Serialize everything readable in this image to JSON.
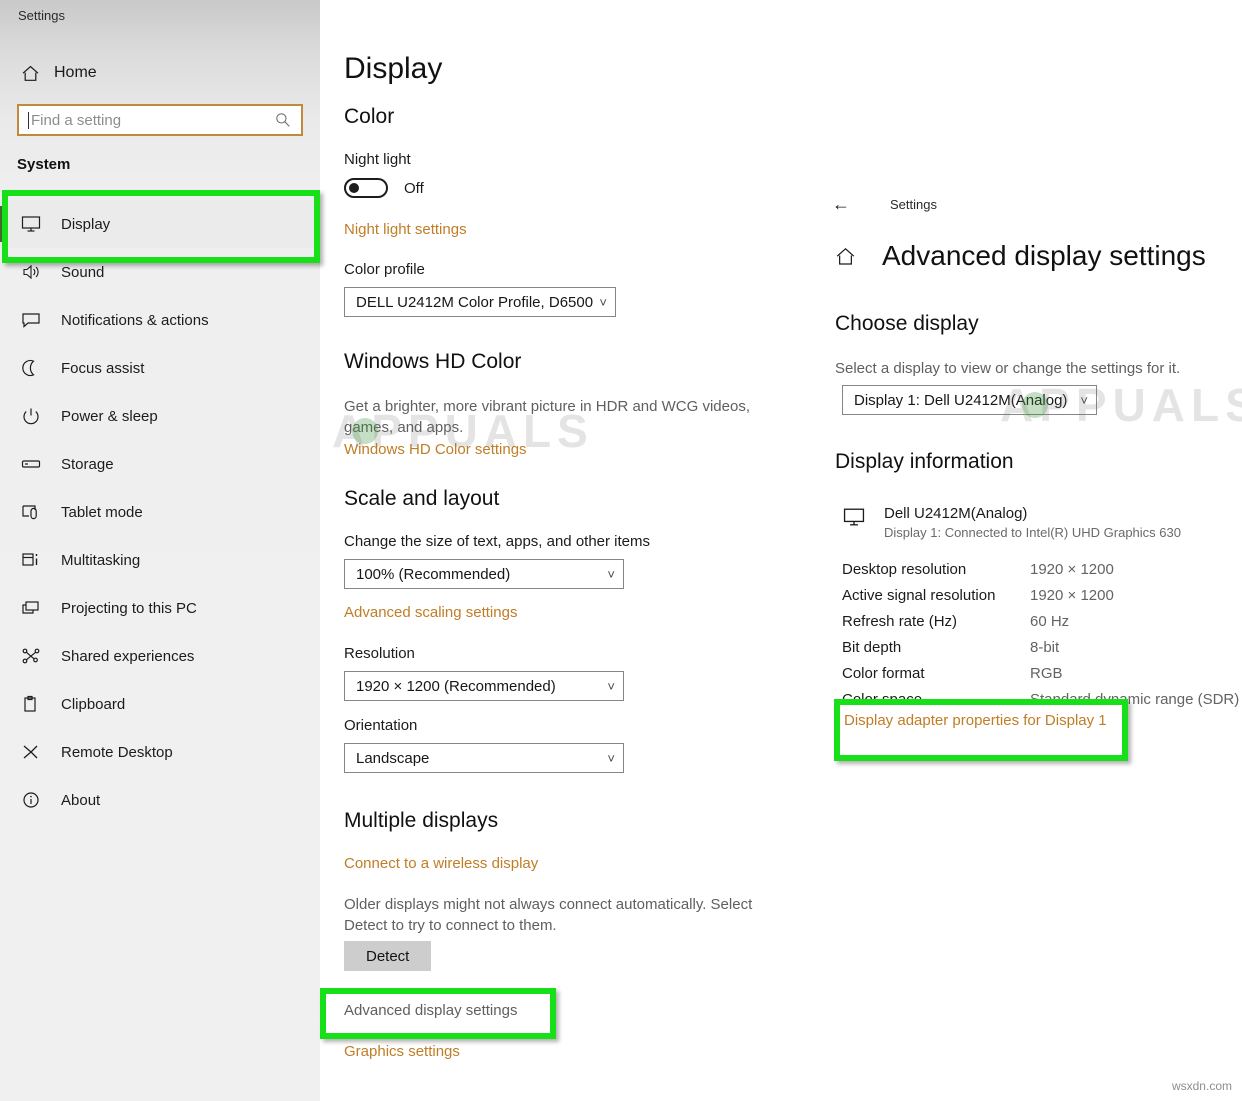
{
  "sidebar": {
    "window_title": "Settings",
    "home_label": "Home",
    "search": {
      "placeholder": "Find a setting",
      "icon": "search-icon"
    },
    "group_heading": "System",
    "items": [
      {
        "label": "Display",
        "icon": "monitor-icon",
        "selected": true
      },
      {
        "label": "Sound",
        "icon": "speaker-icon",
        "selected": false
      },
      {
        "label": "Notifications & actions",
        "icon": "chat-bubble-icon",
        "selected": false
      },
      {
        "label": "Focus assist",
        "icon": "moon-icon",
        "selected": false
      },
      {
        "label": "Power & sleep",
        "icon": "power-icon",
        "selected": false
      },
      {
        "label": "Storage",
        "icon": "drive-icon",
        "selected": false
      },
      {
        "label": "Tablet mode",
        "icon": "tablet-touch-icon",
        "selected": false
      },
      {
        "label": "Multitasking",
        "icon": "multitask-icon",
        "selected": false
      },
      {
        "label": "Projecting to this PC",
        "icon": "project-screen-icon",
        "selected": false
      },
      {
        "label": "Shared experiences",
        "icon": "share-nodes-icon",
        "selected": false
      },
      {
        "label": "Clipboard",
        "icon": "clipboard-icon",
        "selected": false
      },
      {
        "label": "Remote Desktop",
        "icon": "remote-desktop-icon",
        "selected": false
      },
      {
        "label": "About",
        "icon": "info-icon",
        "selected": false
      }
    ]
  },
  "main": {
    "page_title": "Display",
    "color": {
      "heading": "Color",
      "night_light_label": "Night light",
      "night_light_state": "Off",
      "night_light_on": false,
      "night_light_settings_link": "Night light settings",
      "color_profile_label": "Color profile",
      "color_profile_value": "DELL U2412M Color Profile, D6500"
    },
    "hd_color": {
      "heading": "Windows HD Color",
      "description": "Get a brighter, more vibrant picture in HDR and WCG videos, games, and apps.",
      "settings_link": "Windows HD Color settings"
    },
    "scale_layout": {
      "heading": "Scale and layout",
      "scale_label": "Change the size of text, apps, and other items",
      "scale_value": "100% (Recommended)",
      "advanced_scaling_link": "Advanced scaling settings",
      "resolution_label": "Resolution",
      "resolution_value": "1920 × 1200 (Recommended)",
      "orientation_label": "Orientation",
      "orientation_value": "Landscape"
    },
    "multiple_displays": {
      "heading": "Multiple displays",
      "wireless_link": "Connect to a wireless display",
      "description": "Older displays might not always connect automatically. Select Detect to try to connect to them.",
      "detect_button": "Detect",
      "advanced_display_link": "Advanced display settings",
      "graphics_link": "Graphics settings"
    }
  },
  "right_panel": {
    "back_label": "Settings",
    "title": "Advanced display settings",
    "choose_display": {
      "heading": "Choose display",
      "description": "Select a display to view or change the settings for it.",
      "selected_value": "Display 1: Dell U2412M(Analog)"
    },
    "display_information": {
      "heading": "Display information",
      "monitor_name": "Dell U2412M(Analog)",
      "monitor_sub": "Display 1: Connected to Intel(R) UHD Graphics 630",
      "rows": [
        {
          "key": "Desktop resolution",
          "value": "1920 × 1200"
        },
        {
          "key": "Active signal resolution",
          "value": "1920 × 1200"
        },
        {
          "key": "Refresh rate (Hz)",
          "value": "60 Hz"
        },
        {
          "key": "Bit depth",
          "value": "8-bit"
        },
        {
          "key": "Color format",
          "value": "RGB"
        },
        {
          "key": "Color space",
          "value": "Standard dynamic range (SDR)"
        }
      ],
      "adapter_link": "Display adapter properties for Display 1"
    }
  },
  "watermarks": {
    "brand": "APPUALS",
    "site": "wsxdn.com"
  },
  "colors": {
    "accent_link": "#c07d26",
    "highlight_green": "#18e018",
    "selection_bar": "#3f6b2f"
  }
}
